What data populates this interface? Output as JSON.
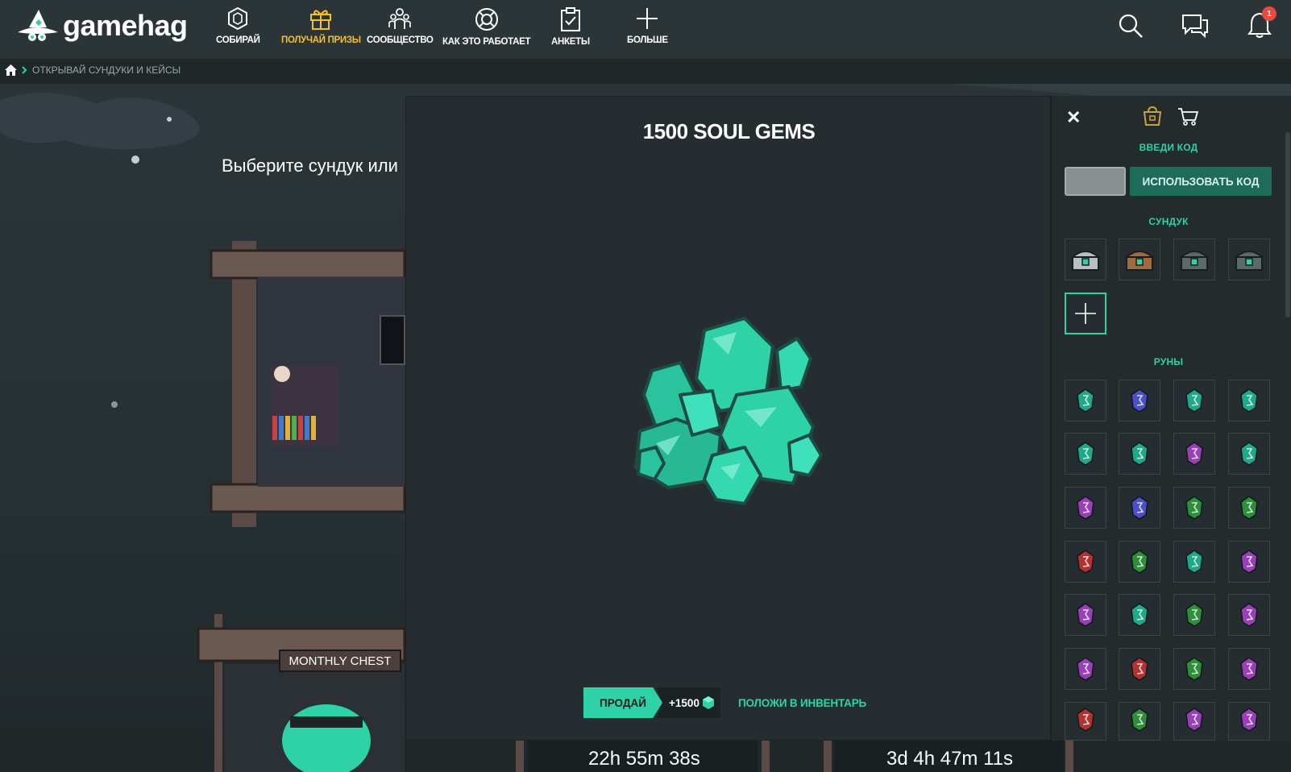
{
  "brand": {
    "name": "gamehag"
  },
  "nav": {
    "items": [
      {
        "label": "СОБИРАЙ",
        "icon": "hexagon-icon",
        "active": false
      },
      {
        "label": "ПОЛУЧАЙ ПРИЗЫ",
        "icon": "gift-icon",
        "active": true
      },
      {
        "label": "СООБЩЕСТВО",
        "icon": "community-icon",
        "active": false
      },
      {
        "label": "КАК ЭТО РАБОТАЕТ",
        "icon": "lifebuoy-icon",
        "active": false
      },
      {
        "label": "АНКЕТЫ",
        "icon": "clipboard-icon",
        "active": false
      },
      {
        "label": "БОЛЬШЕ",
        "icon": "plus-icon",
        "active": false
      }
    ],
    "notification_count": "1"
  },
  "breadcrumb": {
    "current": "ОТКРЫВАЙ СУНДУКИ И КЕЙСЫ"
  },
  "scene": {
    "choose_text": "Выберите сундук или",
    "monthly_chest_label": "MONTHLY CHEST",
    "timers": [
      "22h 55m 38s",
      "3d 4h 47m 11s"
    ]
  },
  "modal": {
    "title": "1500 SOUL GEMS",
    "sell_label": "ПРОДАЙ",
    "sell_value": "+1500",
    "inventory_label": "ПОЛОЖИ В ИНВЕНТАРЬ"
  },
  "panel": {
    "code_heading": "ВВЕДИ КОД",
    "code_input_value": "",
    "code_button_label": "ИСПОЛЬЗОВАТЬ КОД",
    "chest_heading": "СУНДУК",
    "chests": [
      "silver-chest-icon",
      "wooden-chest-icon",
      "dark-chest-icon",
      "dark-chest-icon"
    ],
    "runes_heading": "РУНЫ",
    "runes": [
      [
        "teal",
        "blue",
        "teal",
        "teal"
      ],
      [
        "teal",
        "teal",
        "purple",
        "teal"
      ],
      [
        "purple",
        "blue",
        "green",
        "green"
      ],
      [
        "red",
        "green",
        "teal",
        "purple"
      ],
      [
        "purple",
        "teal",
        "green",
        "purple"
      ],
      [
        "purple",
        "red",
        "green",
        "purple"
      ],
      [
        "red",
        "green",
        "purple",
        "purple"
      ]
    ]
  },
  "colors": {
    "accent": "#2fd1a7",
    "active_nav": "#f2c12e",
    "topbar": "#2b3436",
    "modal_bg": "#252d30",
    "rune_teal": "#1fa98a",
    "rune_blue": "#4d4fc9",
    "rune_purple": "#9a3fb8",
    "rune_green": "#2e8f3a",
    "rune_red": "#b23232"
  }
}
